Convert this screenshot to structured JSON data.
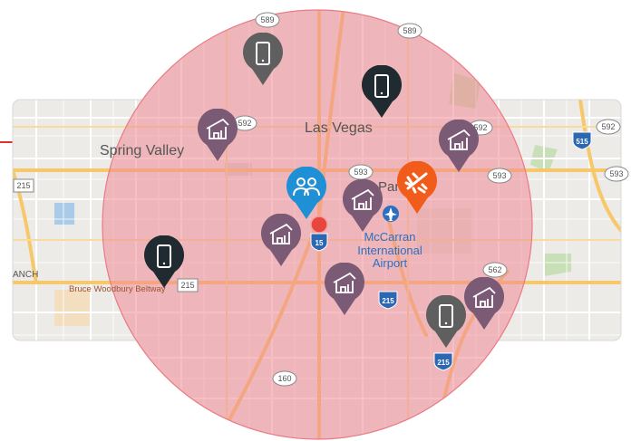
{
  "map": {
    "places": {
      "spring_valley": "Spring Valley",
      "las_vegas": "Las Vegas",
      "paradise": "Paradise",
      "airport_line1": "McCarran",
      "airport_line2": "International",
      "airport_line3": "Airport",
      "beltway": "Bruce Woodbury Beltway",
      "ranch_partial": "ANCH"
    },
    "shields": {
      "s589a": "589",
      "s589b": "589",
      "s592a": "592",
      "s592b": "592",
      "s592c": "592",
      "s593a": "593",
      "s593b": "593",
      "s593c": "593",
      "s215a": "215",
      "s215b": "215",
      "s215c": "215",
      "s215d": "215",
      "s562": "562",
      "s515": "515",
      "s160": "160",
      "i15": "15"
    },
    "radius_color": "#f08a93",
    "pins": [
      {
        "kind": "mobile",
        "color": "#5f5f5f"
      },
      {
        "kind": "mobile",
        "color": "#1f2a31"
      },
      {
        "kind": "house",
        "color": "#7b5a75"
      },
      {
        "kind": "house",
        "color": "#7b5a75"
      },
      {
        "kind": "people",
        "color": "#1f8fd6"
      },
      {
        "kind": "house",
        "color": "#7b5a75"
      },
      {
        "kind": "plane",
        "color": "#f25c1a"
      },
      {
        "kind": "house",
        "color": "#7b5a75"
      },
      {
        "kind": "mobile",
        "color": "#1f2a31"
      },
      {
        "kind": "house",
        "color": "#7b5a75"
      },
      {
        "kind": "mobile",
        "color": "#5f5f5f"
      },
      {
        "kind": "house",
        "color": "#7b5a75"
      }
    ]
  }
}
